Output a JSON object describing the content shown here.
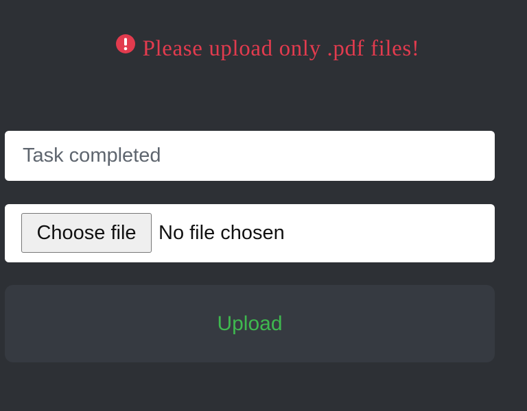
{
  "alert": {
    "icon": "exclamation-circle-icon",
    "message": "Please upload only .pdf files!",
    "color": "#e23b4e"
  },
  "form": {
    "task_field": {
      "value": "Task completed"
    },
    "file_picker": {
      "button_label": "Choose file",
      "status_text": "No file chosen"
    },
    "upload_button": {
      "label": "Upload",
      "color": "#3fb94f"
    }
  },
  "theme": {
    "background": "#2d3035",
    "button_background": "#363a41"
  }
}
